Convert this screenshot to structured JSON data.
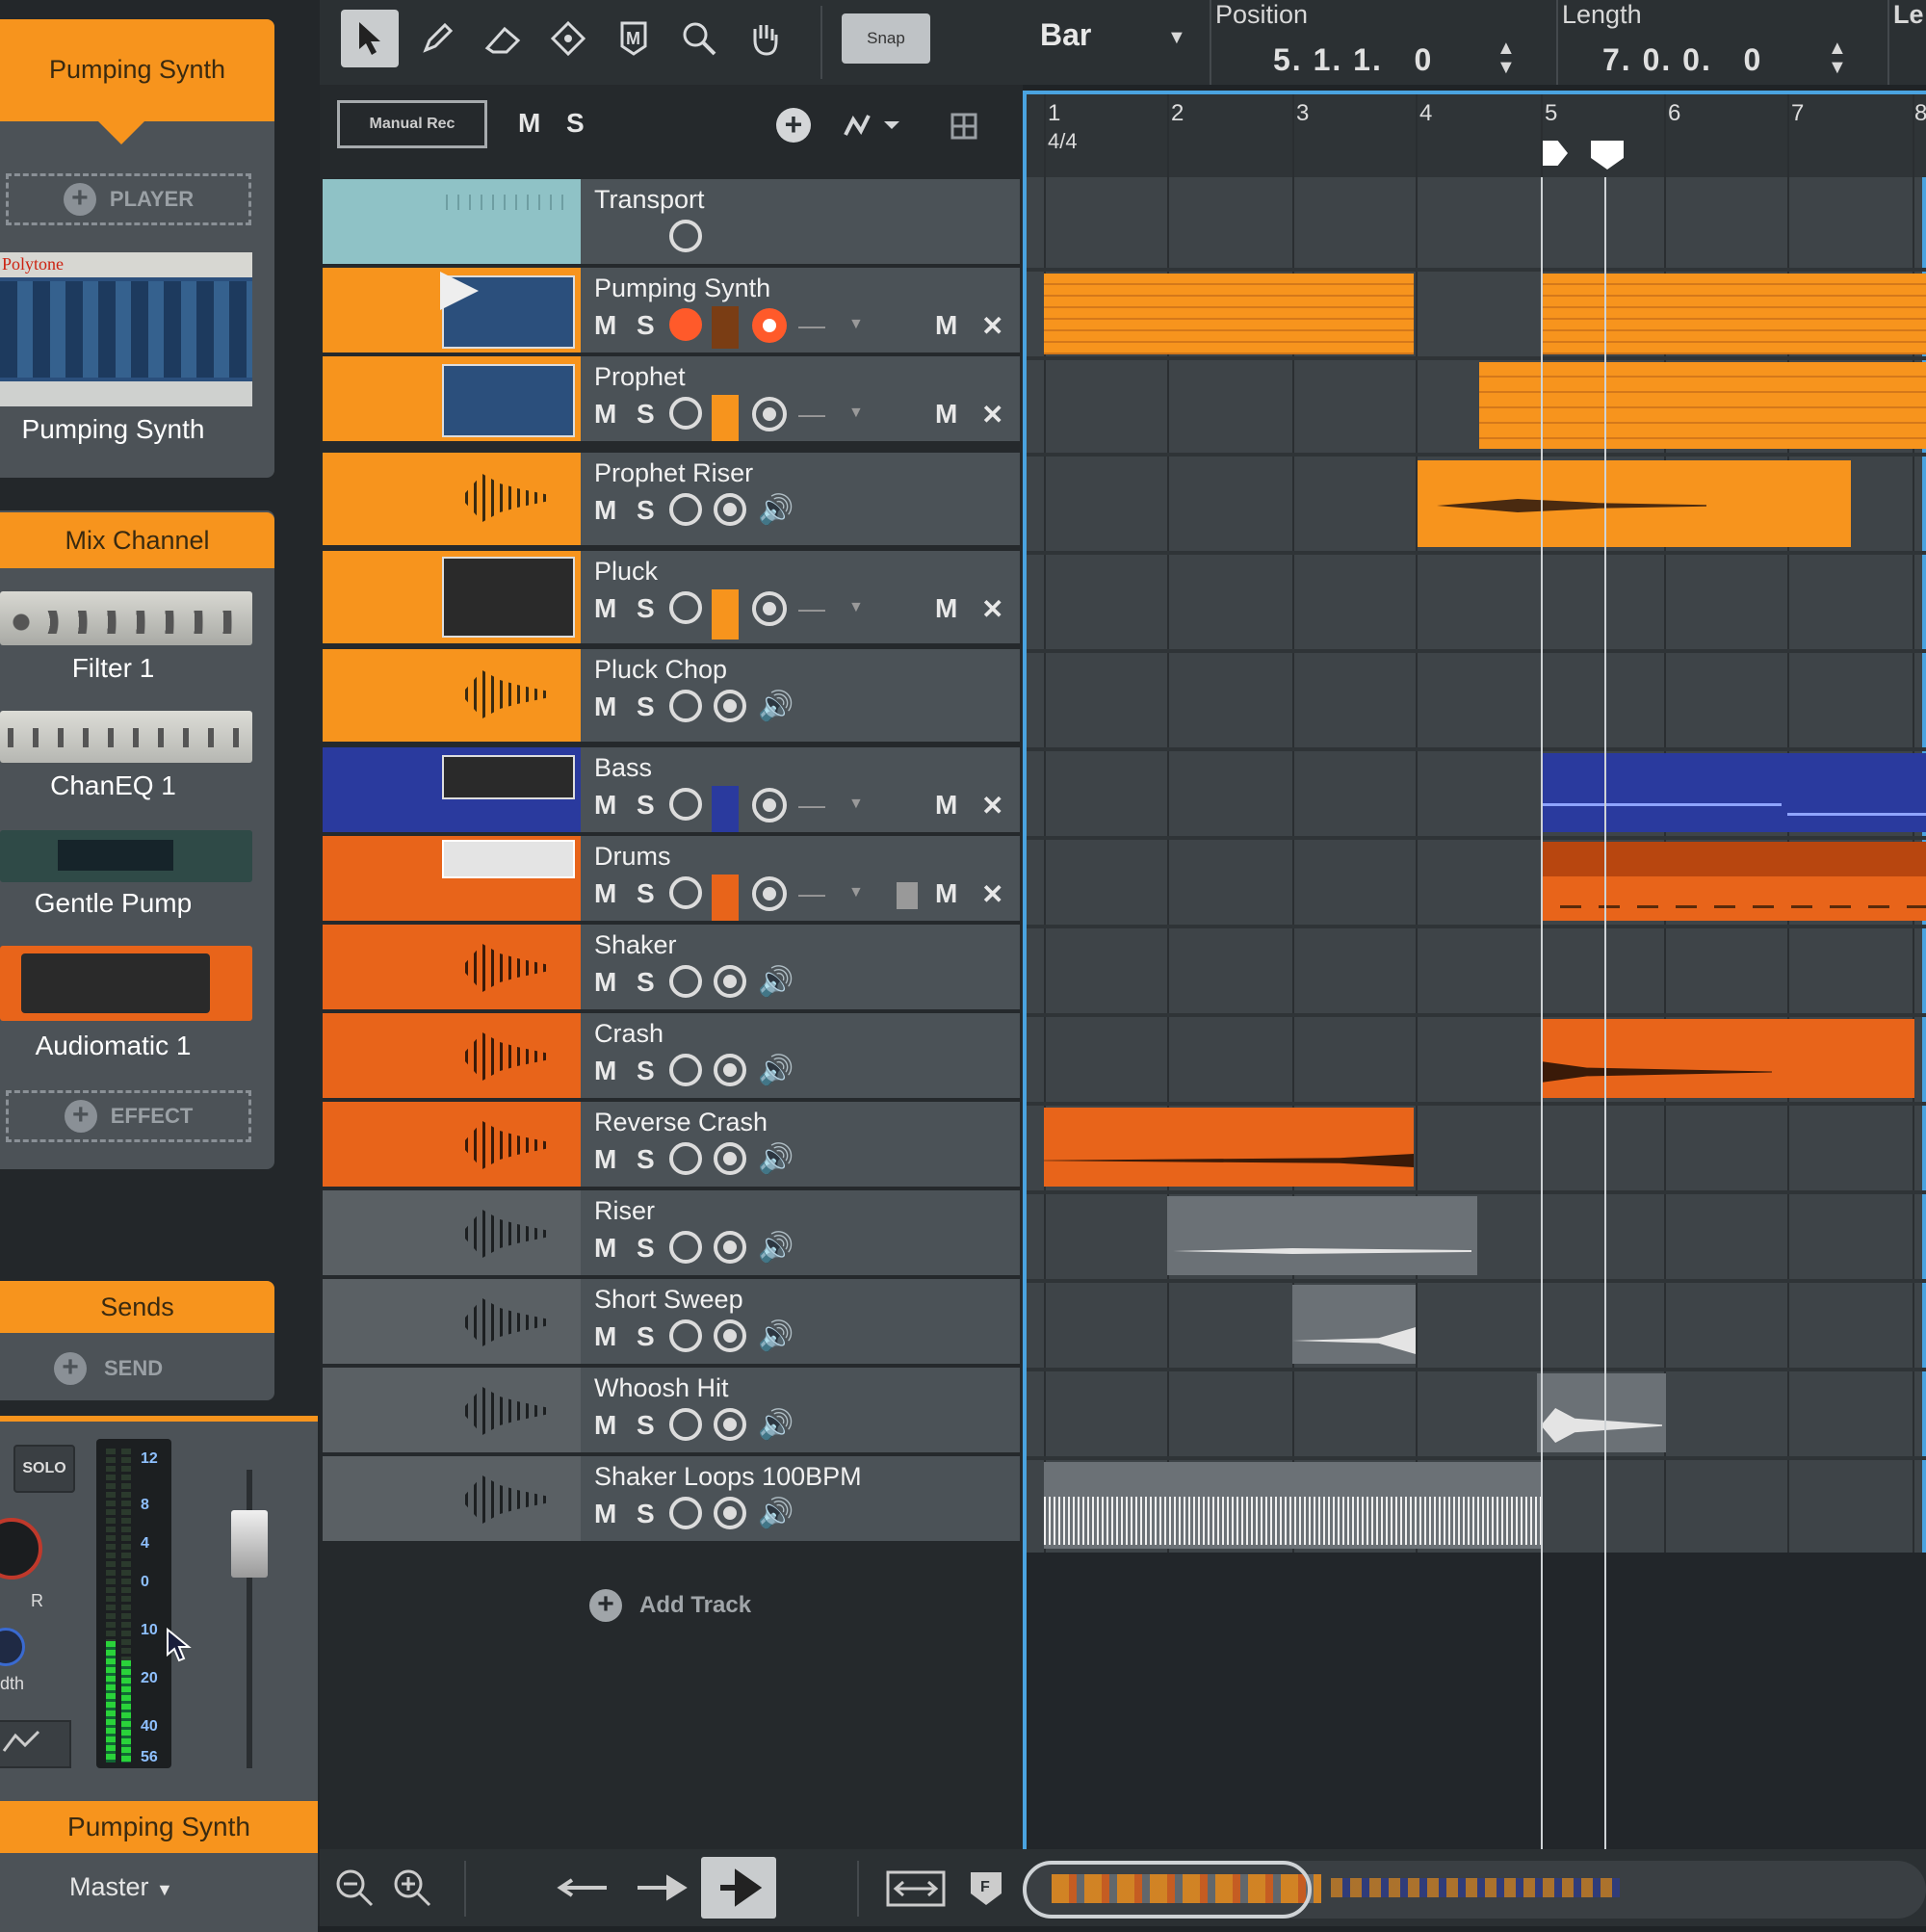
{
  "left_panel": {
    "instrument_title": "Pumping Synth",
    "player_slot": "PLAYER",
    "instrument_device": "Pumping Synth",
    "instrument_device_brand": "Polytone",
    "mix_channel_title": "Mix Channel",
    "effects": [
      "Filter 1",
      "ChanEQ 1",
      "Gentle Pump",
      "Audiomatic 1"
    ],
    "effect_slot": "EFFECT",
    "sends_title": "Sends",
    "send_slot": "SEND"
  },
  "mixer": {
    "solo_label": "SOLO",
    "pan_label": "R",
    "width_label": "dth",
    "meter_ticks": [
      "12",
      "8",
      "4",
      "0",
      "10",
      "20",
      "40",
      "56"
    ],
    "channel_name": "Pumping Synth",
    "output": "Master"
  },
  "toolbar": {
    "snap_label": "Snap",
    "grid_label": "Bar",
    "position_label": "Position",
    "position_value": "5. 1. 1.   0",
    "length_label": "Length",
    "length_value": "7. 0. 0.   0",
    "cut_label": "Le"
  },
  "header_row": {
    "manual_rec": "Manual Rec",
    "mute": "M",
    "solo": "S"
  },
  "ruler": {
    "bars": [
      "1",
      "2",
      "3",
      "4",
      "5",
      "6",
      "7",
      "8"
    ],
    "time_signature": "4/4"
  },
  "tracks": [
    {
      "name": "Transport"
    },
    {
      "name": "Pumping Synth"
    },
    {
      "name": "Prophet"
    },
    {
      "name": "Prophet Riser"
    },
    {
      "name": "Pluck"
    },
    {
      "name": "Pluck Chop"
    },
    {
      "name": "Bass"
    },
    {
      "name": "Drums"
    },
    {
      "name": "Shaker"
    },
    {
      "name": "Crash"
    },
    {
      "name": "Reverse Crash"
    },
    {
      "name": "Riser"
    },
    {
      "name": "Short Sweep"
    },
    {
      "name": "Whoosh Hit"
    },
    {
      "name": "Shaker Loops 100BPM"
    }
  ],
  "buttons": {
    "m": "M",
    "s": "S",
    "x": "✕",
    "dash": "—"
  },
  "add_track": "Add Track",
  "colors": {
    "orange": "#f7941d",
    "dark_orange": "#e8641a",
    "blue": "#2a3a9e",
    "teal": "#8fc2c6",
    "selection": "#4aa3e0"
  }
}
